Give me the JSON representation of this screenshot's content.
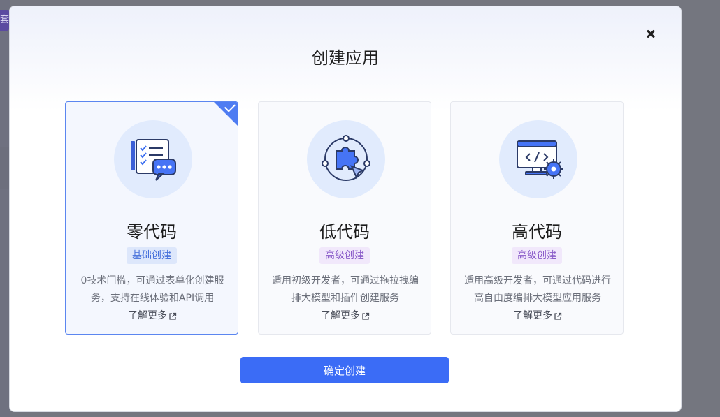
{
  "background": {
    "tag_text": "套"
  },
  "modal": {
    "title": "创建应用",
    "close_icon": "close-icon",
    "confirm_label": "确定创建",
    "accent_color": "#3b6cf6"
  },
  "cards": [
    {
      "title": "零代码",
      "badge": "基础创建",
      "description": "0技术门槛，可通过表单化创建服务，支持在线体验和API调用",
      "learn_more": "了解更多",
      "icon": "form-chat-icon",
      "selected": true
    },
    {
      "title": "低代码",
      "badge": "高级创建",
      "description": "适用初级开发者，可通过拖拉拽编排大模型和插件创建服务",
      "learn_more": "了解更多",
      "icon": "puzzle-cursor-icon",
      "selected": false
    },
    {
      "title": "高代码",
      "badge": "高级创建",
      "description": "适用高级开发者，可通过代码进行高自由度编排大模型应用服务",
      "learn_more": "了解更多",
      "icon": "code-gear-icon",
      "selected": false
    }
  ]
}
